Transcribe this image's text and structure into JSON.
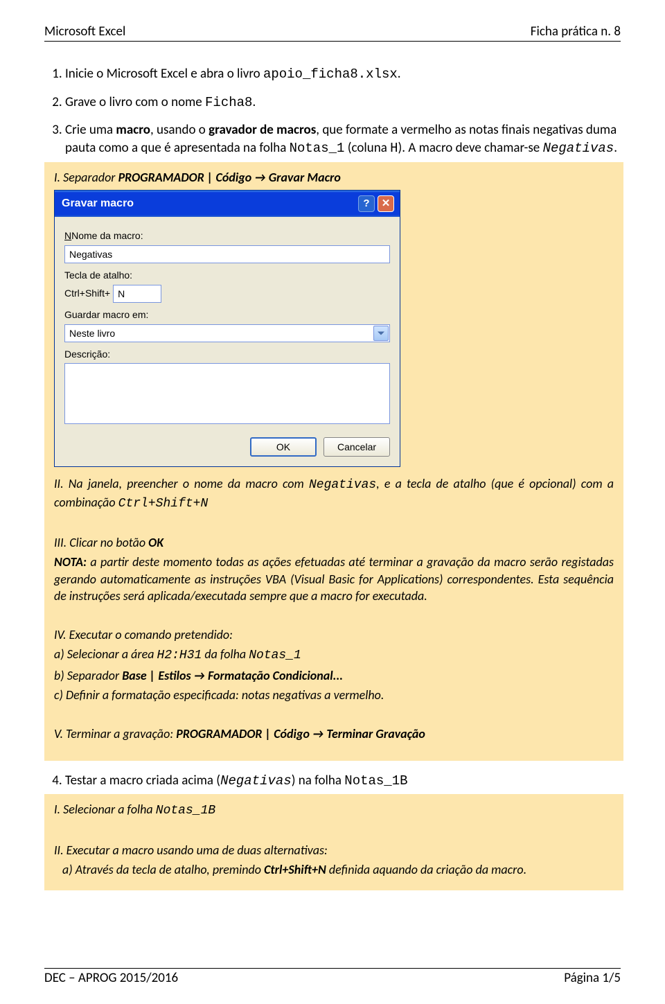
{
  "header": {
    "left": "Microsoft Excel",
    "right": "Ficha prática n. 8"
  },
  "footer": {
    "left": "DEC – APROG 2015/2016",
    "right": "Página 1/5"
  },
  "item1": {
    "prefix": "Inicie o Microsoft Excel e abra o livro ",
    "file": "apoio_ficha8.xlsx",
    "suffix": "."
  },
  "item2": {
    "prefix": "Grave o livro com o nome ",
    "file": "Ficha8",
    "suffix": "."
  },
  "item3": {
    "t1": "Crie uma ",
    "b1": "macro",
    "t2": ", usando o ",
    "b2": "gravador de macros",
    "t3": ", que formate a vermelho as notas finais negativas duma pauta como a que é apresentada na folha ",
    "m1": "Notas_1",
    "t4": " (coluna ",
    "m2": "H",
    "t5": "). A macro deve chamar-se ",
    "m3": "Negativas",
    "t6": "."
  },
  "tip3_i": {
    "prefix": "I. Separador ",
    "bold": "PROGRAMADOR | Código → Gravar Macro"
  },
  "dialog": {
    "title": "Gravar macro",
    "lbl_name": "Nome da macro:",
    "name_value": "Negativas",
    "lbl_shortcut": "Tecla de atalho:",
    "shortcut_prefix": "Ctrl+Shift+",
    "shortcut_key": "N",
    "lbl_store": "Guardar macro em:",
    "store_value": "Neste livro",
    "lbl_desc": "Descrição:",
    "desc_value": "",
    "ok": "OK",
    "cancel": "Cancelar"
  },
  "tip3_ii": {
    "t1": "II. Na janela, preencher o nome da macro com ",
    "m1": "Negativas",
    "t2": ", e a tecla de atalho (que é opcional) com a combinação ",
    "m2": "Ctrl+Shift+N"
  },
  "tip3_iii": {
    "t1": "III. Clicar no botão ",
    "b1": "OK"
  },
  "tip3_nota": {
    "b1": "NOTA:",
    "text": " a partir deste momento todas as ações efetuadas até terminar a gravação da macro serão registadas gerando automaticamente as instruções VBA (Visual Basic for Applications) correspondentes. Esta sequência de instruções será aplicada/executada sempre que a macro for executada."
  },
  "tip3_iv": {
    "head": "IV. Executar o comando pretendido:",
    "a_1": "a) Selecionar a área ",
    "a_m1": "H2:H31",
    "a_2": " da folha ",
    "a_m2": "Notas_1",
    "b_1": "b) Separador ",
    "b_b": "Base | Estilos → Formatação Condicional...",
    "c": "c) Definir a formatação especificada: notas negativas a vermelho."
  },
  "tip3_v": {
    "t1": "V. Terminar a gravação: ",
    "b1": "PROGRAMADOR | Código → Terminar Gravação"
  },
  "item4": {
    "t1": "Testar a macro criada acima (",
    "m1": "Negativas",
    "t2": ") na folha ",
    "m2": "Notas_1B"
  },
  "tip4_i": {
    "t1": "I. Selecionar a folha ",
    "m1": "Notas_1B"
  },
  "tip4_ii": {
    "head": "II. Executar a macro usando uma de duas alternativas:",
    "a_1": "a) Através da tecla de atalho, premindo ",
    "a_b": "Ctrl+Shift+N",
    "a_2": " definida aquando da criação da macro."
  }
}
